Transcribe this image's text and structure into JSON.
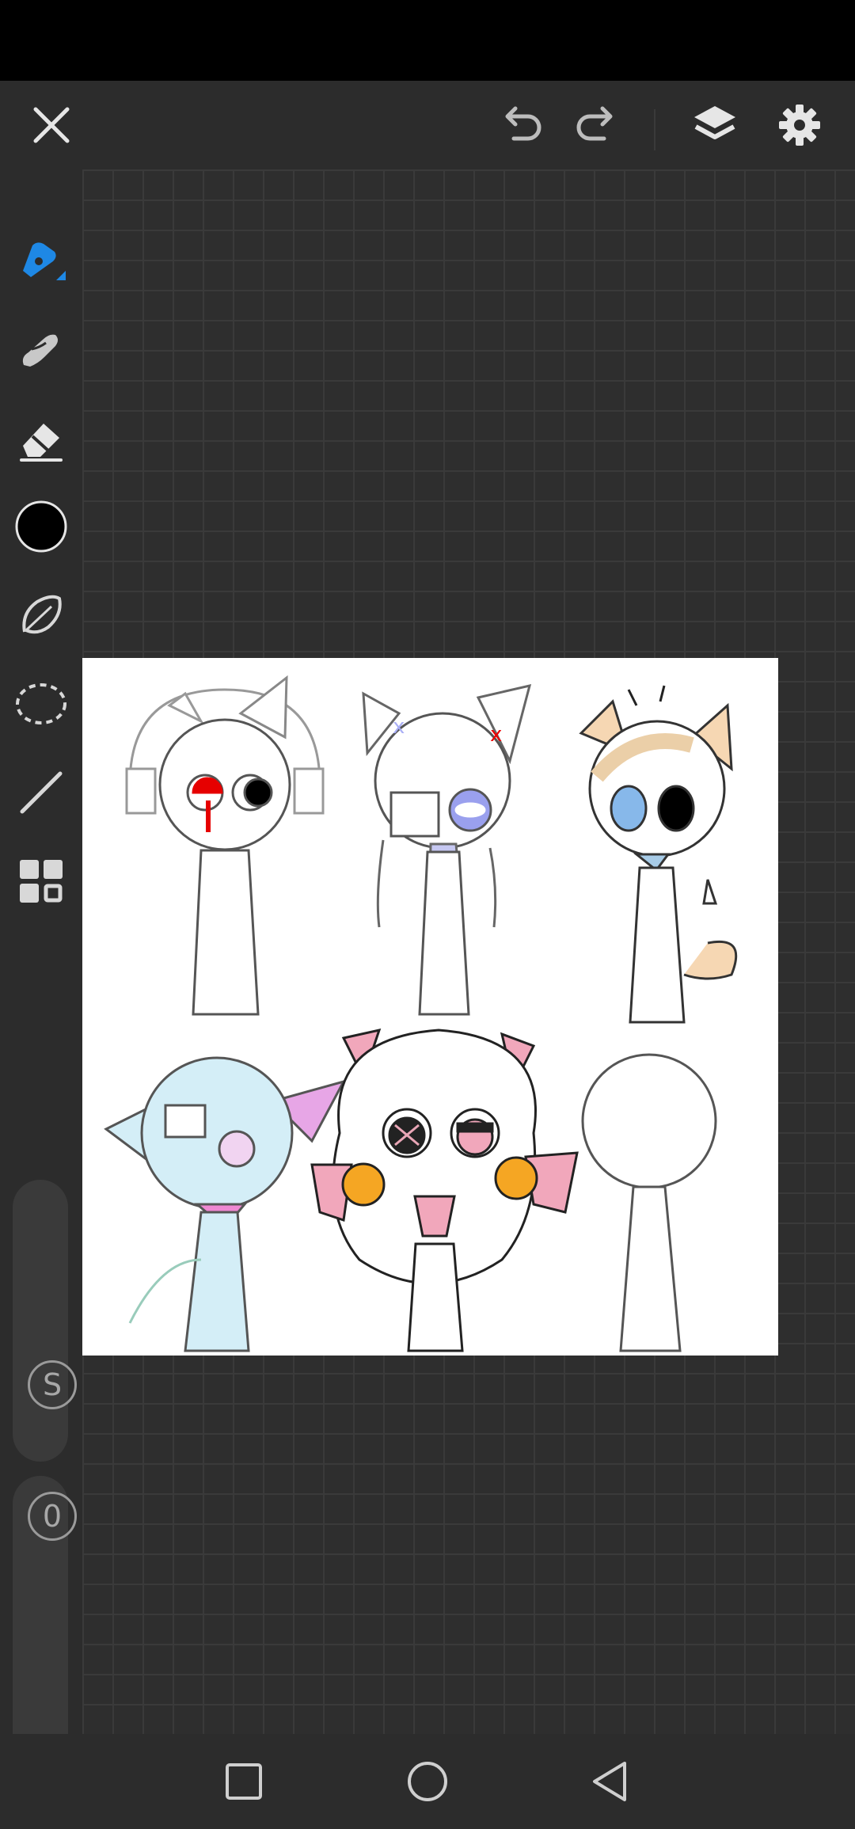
{
  "colors": {
    "accent": "#1e88e5",
    "current_color": "#000000",
    "background": "#2b2b2b",
    "canvas": "#ffffff"
  },
  "toolbar": {
    "icons": [
      "close-icon",
      "undo-icon",
      "redo-icon",
      "layers-icon",
      "settings-icon"
    ]
  },
  "tools": [
    {
      "icon": "pen-icon",
      "selected": true
    },
    {
      "icon": "smudge-icon",
      "selected": false
    },
    {
      "icon": "eraser-icon",
      "selected": false
    },
    {
      "icon": "color-swatch",
      "selected": false
    },
    {
      "icon": "lasso-icon",
      "selected": false
    },
    {
      "icon": "selection-icon",
      "selected": false
    },
    {
      "icon": "line-icon",
      "selected": false
    },
    {
      "icon": "grid-menu-icon",
      "selected": false
    }
  ],
  "sliders": {
    "size_badge": "S",
    "opacity_badge": "0"
  },
  "navigation": {
    "icons": [
      "recents-icon",
      "home-icon",
      "back-icon"
    ]
  }
}
